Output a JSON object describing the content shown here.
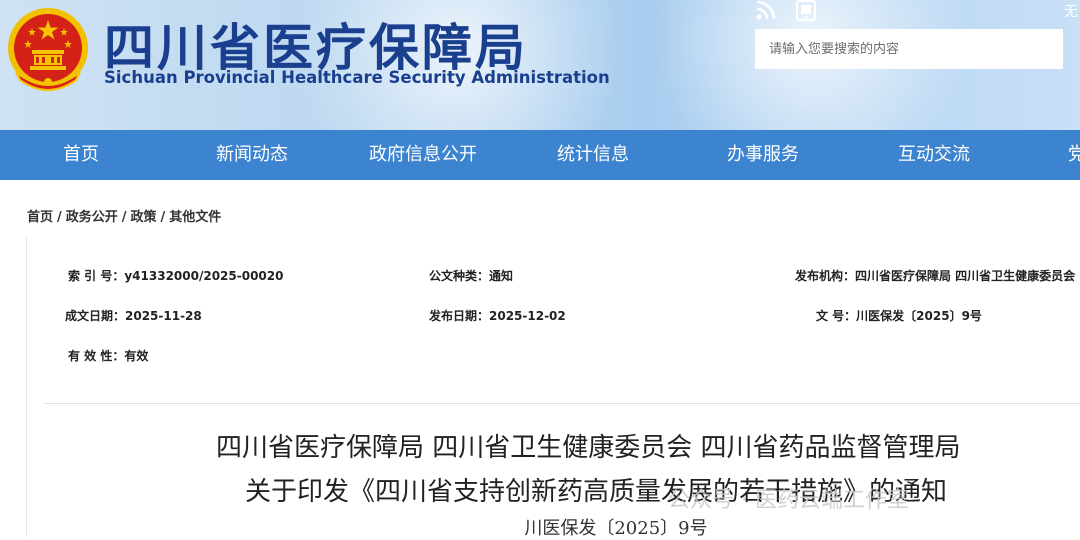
{
  "header": {
    "title_cn": "四川省医疗保障局",
    "title_en": "Sichuan Provincial Healthcare Security Administration",
    "corner_link": "无",
    "icons": [
      "rss-icon",
      "mobile-icon"
    ],
    "search": {
      "placeholder": "请输入您要搜索的内容"
    }
  },
  "nav": {
    "items": [
      "首页",
      "新闻动态",
      "政府信息公开",
      "统计信息",
      "办事服务",
      "互动交流",
      "党"
    ]
  },
  "breadcrumb": {
    "items": [
      "首页",
      "政务公开",
      "政策",
      "其他文件"
    ],
    "separator": "/"
  },
  "info": {
    "index_no": "索 引 号：y41332000/2025-00020",
    "doc_type": "公文种类：通知",
    "publisher": "发布机构：四川省医疗保障局  四川省卫生健康委员会",
    "created": "成文日期：2025-11-28",
    "published": "发布日期：2025-12-02",
    "doc_number": "文  号：川医保发〔2025〕9号",
    "validity": "有 效 性：有效"
  },
  "document": {
    "title_line1": "四川省医疗保障局  四川省卫生健康委员会  四川省药品监督管理局",
    "title_line2": "关于印发《四川省支持创新药高质量发展的若干措施》的通知",
    "number": "川医保发〔2025〕9号"
  },
  "watermark": "公众号 · 医药云端工作室",
  "colors": {
    "nav_bg": "#3d84d0",
    "title_blue": "#1b3f8f",
    "emblem_red": "#d42218",
    "emblem_gold": "#f5c400"
  }
}
